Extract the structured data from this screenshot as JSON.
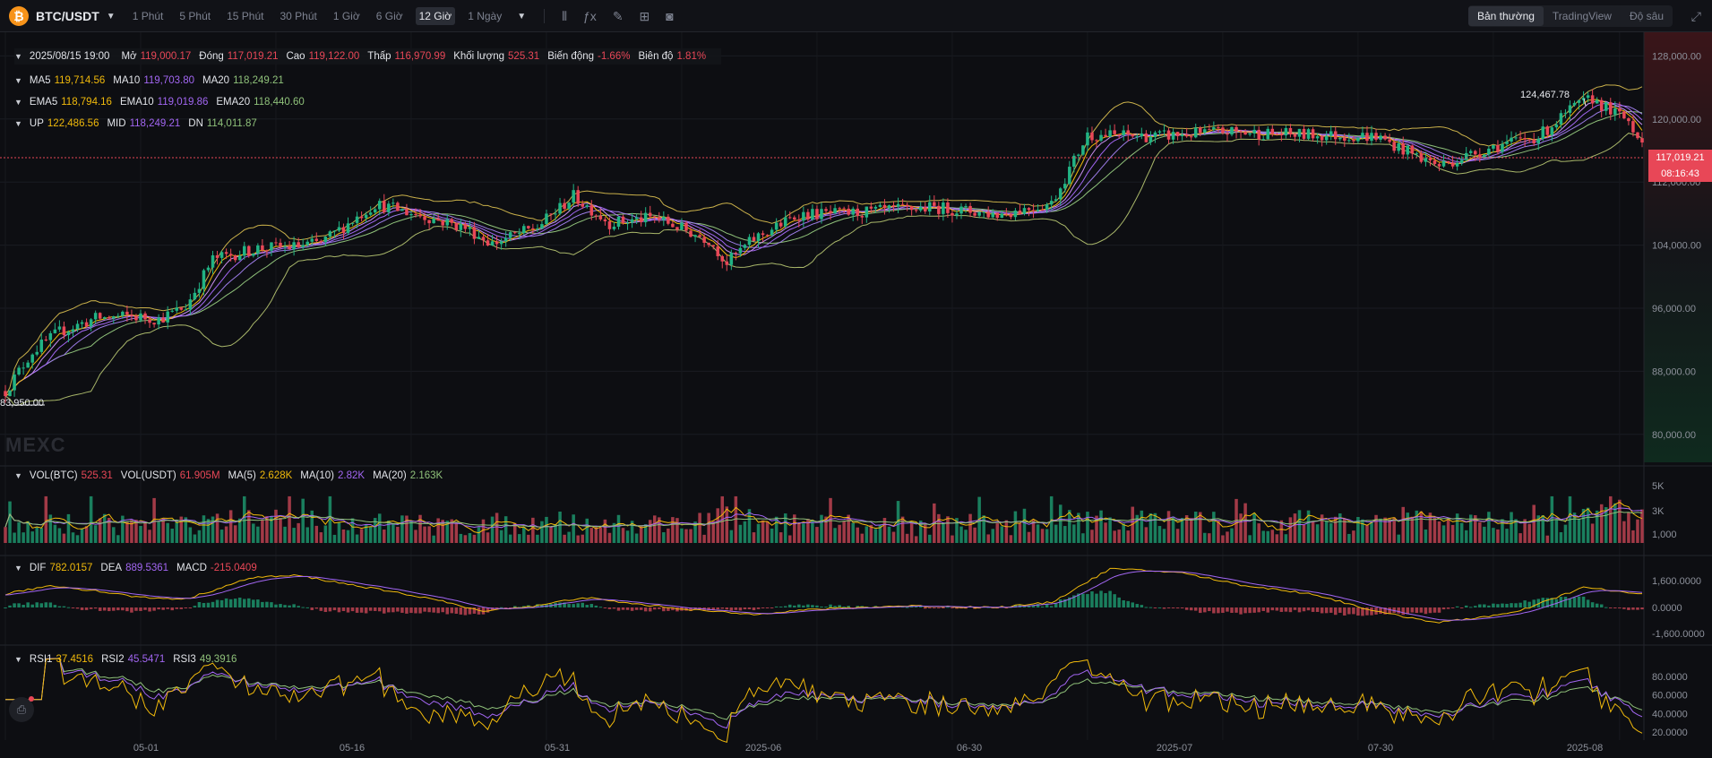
{
  "toolbar": {
    "symbol": "BTC/USDT",
    "coin_icon": "bitcoin-icon",
    "intervals": [
      "1 Phút",
      "5 Phút",
      "15 Phút",
      "30 Phút",
      "1 Giờ",
      "6 Giờ",
      "12 Giờ",
      "1 Ngày"
    ],
    "active_interval": "12 Giờ",
    "tools": [
      "indicator-icon",
      "formula-icon",
      "draw-pencil-icon",
      "layout-grid-icon",
      "camera-icon"
    ],
    "views": [
      "Bản thường",
      "TradingView",
      "Độ sâu"
    ],
    "active_view": "Bản thường",
    "fullscreen_icon": "fullscreen-icon"
  },
  "ohlc": {
    "date": "2025/08/15 19:00",
    "open_label": "Mở",
    "open": "119,000.17",
    "close_label": "Đóng",
    "close": "117,019.21",
    "high_label": "Cao",
    "high": "119,122.00",
    "low_label": "Thấp",
    "low": "116,970.99",
    "volume_label": "Khối lượng",
    "volume": "525.31",
    "change_label": "Biến động",
    "change": "-1.66%",
    "amplitude_label": "Biên độ",
    "amplitude": "1.81%"
  },
  "ma": {
    "ma5_label": "MA5",
    "ma5": "119,714.56",
    "ma10_label": "MA10",
    "ma10": "119,703.80",
    "ma20_label": "MA20",
    "ma20": "118,249.21"
  },
  "ema": {
    "ema5_label": "EMA5",
    "ema5": "118,794.16",
    "ema10_label": "EMA10",
    "ema10": "119,019.86",
    "ema20_label": "EMA20",
    "ema20": "118,440.60"
  },
  "boll": {
    "up_label": "UP",
    "up": "122,486.56",
    "mid_label": "MID",
    "mid": "118,249.21",
    "dn_label": "DN",
    "dn": "114,011.87"
  },
  "vol_legend": {
    "btc_label": "VOL(BTC)",
    "btc": "525.31",
    "usdt_label": "VOL(USDT)",
    "usdt": "61.905M",
    "ma5_label": "MA(5)",
    "ma5": "2.628K",
    "ma10_label": "MA(10)",
    "ma10": "2.82K",
    "ma20_label": "MA(20)",
    "ma20": "2.163K"
  },
  "macd_legend": {
    "dif_label": "DIF",
    "dif": "782.0157",
    "dea_label": "DEA",
    "dea": "889.5361",
    "macd_label": "MACD",
    "macd": "-215.0409"
  },
  "rsi_legend": {
    "rsi1_label": "RSI1",
    "rsi1": "37.4516",
    "rsi2_label": "RSI2",
    "rsi2": "45.5471",
    "rsi3_label": "RSI3",
    "rsi3": "49.3916"
  },
  "current_price": "117,019.21",
  "countdown": "08:16:43",
  "high_marker": "124,467.78",
  "low_marker": "83,950.00",
  "watermark": "MEXC",
  "corner_icon": "alert-bell-icon",
  "colors": {
    "up": "#21b384",
    "down": "#e84757",
    "ma5": "#f0b90b",
    "ma10": "#a266f2",
    "ma20": "#8fc17a",
    "bg": "#0d0e12"
  },
  "chart_data": {
    "type": "candlestick",
    "price_axis_ticks": [
      "128,000.00",
      "120,000.00",
      "112,000.00",
      "104,000.00",
      "96,000.00",
      "88,000.00",
      "80,000.00"
    ],
    "price_range": [
      76000,
      131000
    ],
    "volume_axis_ticks": [
      "5K",
      "3K",
      "1,000"
    ],
    "macd_axis_ticks": [
      "1,600.0000",
      "0.0000",
      "-1,600.0000"
    ],
    "rsi_axis_ticks": [
      "80.0000",
      "60.0000",
      "40.0000",
      "20.0000"
    ],
    "x_ticks": [
      "05-01",
      "05-16",
      "05-31",
      "2025-06",
      "06-30",
      "2025-07",
      "07-30",
      "2025-08"
    ],
    "anchors_price": [
      [
        0,
        85500
      ],
      [
        6,
        90500
      ],
      [
        12,
        93000
      ],
      [
        20,
        94700
      ],
      [
        28,
        95000
      ],
      [
        34,
        94600
      ],
      [
        40,
        96200
      ],
      [
        46,
        102200
      ],
      [
        56,
        103600
      ],
      [
        64,
        103800
      ],
      [
        70,
        104300
      ],
      [
        82,
        109200
      ],
      [
        92,
        107800
      ],
      [
        102,
        106200
      ],
      [
        108,
        104200
      ],
      [
        118,
        106300
      ],
      [
        126,
        110200
      ],
      [
        134,
        106800
      ],
      [
        144,
        107500
      ],
      [
        156,
        104700
      ],
      [
        160,
        101800
      ],
      [
        166,
        104800
      ],
      [
        176,
        107900
      ],
      [
        186,
        108000
      ],
      [
        196,
        108400
      ],
      [
        206,
        108800
      ],
      [
        220,
        107900
      ],
      [
        232,
        109300
      ],
      [
        240,
        118000
      ],
      [
        256,
        117800
      ],
      [
        270,
        118400
      ],
      [
        282,
        118100
      ],
      [
        294,
        117900
      ],
      [
        304,
        117800
      ],
      [
        312,
        115600
      ],
      [
        318,
        114100
      ],
      [
        330,
        116500
      ],
      [
        340,
        117800
      ],
      [
        348,
        121500
      ],
      [
        352,
        122600
      ],
      [
        356,
        121000
      ],
      [
        360,
        119800
      ],
      [
        363,
        117019
      ]
    ],
    "anchors_volume": [
      [
        0,
        1600
      ],
      [
        20,
        2200
      ],
      [
        40,
        1900
      ],
      [
        60,
        2400
      ],
      [
        80,
        2000
      ],
      [
        100,
        1800
      ],
      [
        120,
        2100
      ],
      [
        140,
        1900
      ],
      [
        160,
        2400
      ],
      [
        180,
        1800
      ],
      [
        200,
        1900
      ],
      [
        220,
        2000
      ],
      [
        240,
        2800
      ],
      [
        260,
        2100
      ],
      [
        280,
        2000
      ],
      [
        300,
        2600
      ],
      [
        320,
        2100
      ],
      [
        340,
        2000
      ],
      [
        355,
        3000
      ],
      [
        363,
        2600
      ]
    ],
    "anchors_dif": [
      [
        0,
        800
      ],
      [
        10,
        1300
      ],
      [
        20,
        1000
      ],
      [
        30,
        600
      ],
      [
        40,
        500
      ],
      [
        55,
        1800
      ],
      [
        65,
        1900
      ],
      [
        80,
        1200
      ],
      [
        95,
        500
      ],
      [
        105,
        -200
      ],
      [
        118,
        100
      ],
      [
        128,
        600
      ],
      [
        140,
        200
      ],
      [
        155,
        -200
      ],
      [
        165,
        -400
      ],
      [
        180,
        -100
      ],
      [
        200,
        100
      ],
      [
        220,
        0
      ],
      [
        232,
        300
      ],
      [
        245,
        2300
      ],
      [
        260,
        2100
      ],
      [
        275,
        1300
      ],
      [
        290,
        800
      ],
      [
        305,
        -300
      ],
      [
        318,
        -900
      ],
      [
        335,
        -300
      ],
      [
        350,
        1200
      ],
      [
        363,
        782
      ]
    ]
  }
}
